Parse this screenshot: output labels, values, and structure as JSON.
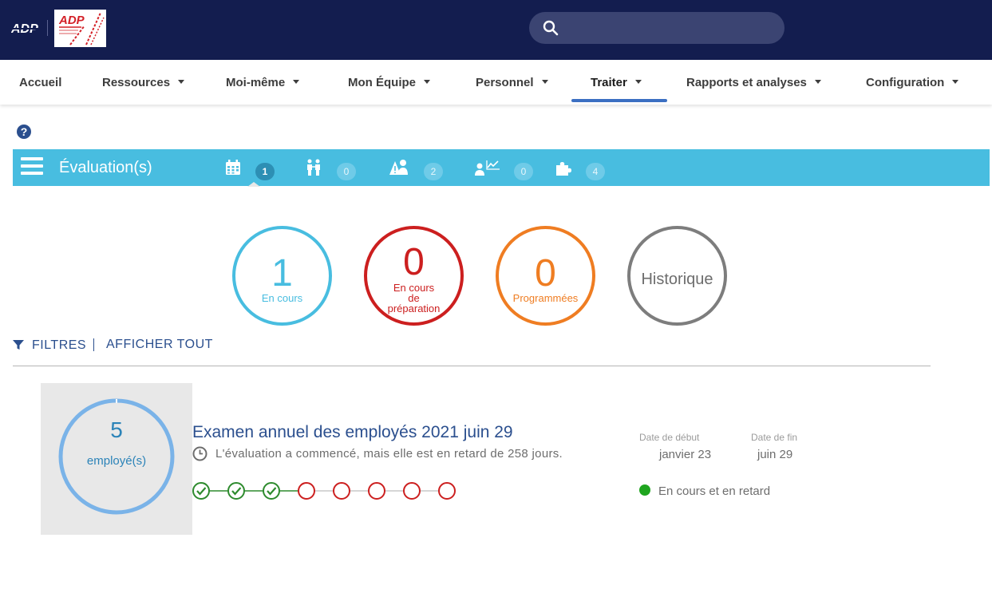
{
  "header": {
    "search": {
      "placeholder": "",
      "value": ""
    }
  },
  "nav": {
    "items": [
      {
        "label": "Accueil",
        "has_menu": false
      },
      {
        "label": "Ressources",
        "has_menu": true
      },
      {
        "label": "Moi-même",
        "has_menu": true
      },
      {
        "label": "Mon Équipe",
        "has_menu": true
      },
      {
        "label": "Personnel",
        "has_menu": true
      },
      {
        "label": "Traiter",
        "has_menu": true,
        "active": true
      },
      {
        "label": "Rapports et analyses",
        "has_menu": true
      },
      {
        "label": "Configuration",
        "has_menu": true
      }
    ]
  },
  "evaluation_bar": {
    "title": "Évaluation(s)",
    "tabs": [
      {
        "icon": "calendar-icon",
        "count": "1",
        "active": true
      },
      {
        "icon": "people-icon",
        "count": "0"
      },
      {
        "icon": "warning-person-icon",
        "count": "2"
      },
      {
        "icon": "person-chart-icon",
        "count": "0"
      },
      {
        "icon": "puzzle-icon",
        "count": "4"
      }
    ]
  },
  "summary": {
    "in_progress": {
      "count": "1",
      "label": "En cours"
    },
    "in_preparation": {
      "count": "0",
      "label_lines": [
        "En cours",
        "de",
        "préparation"
      ]
    },
    "scheduled": {
      "count": "0",
      "label": "Programmées"
    },
    "history": {
      "label": "Historique"
    }
  },
  "filters": {
    "filters_label": "FILTRES",
    "show_all_label": "AFFICHER TOUT"
  },
  "review": {
    "employee_count": "5",
    "employee_label": "employé(s)",
    "title": "Examen annuel des employés 2021 juin 29",
    "status_message": "L'évaluation a commencé, mais elle est en retard de 258 jours.",
    "steps_completed": 3,
    "steps_total": 8,
    "start_date_label": "Date de début",
    "start_date": "janvier 23",
    "end_date_label": "Date de fin",
    "end_date": "juin 29",
    "status": "En cours et en retard"
  },
  "colors": {
    "header_bg": "#131d4f",
    "bar_bg": "#48bde0",
    "in_progress": "#48bde0",
    "preparation": "#cc1f1f",
    "scheduled": "#ef7d22",
    "history": "#7d7d7d",
    "step_done": "#2e8b2e",
    "step_pending": "#cc1f1f",
    "status_ok": "#1fa51f"
  }
}
